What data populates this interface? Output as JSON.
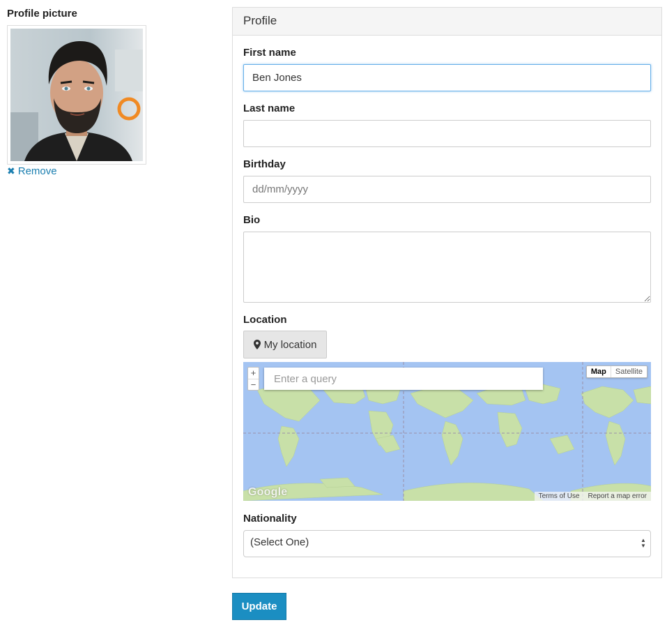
{
  "profile_picture": {
    "title": "Profile picture",
    "remove_label": "Remove"
  },
  "panel": {
    "heading": "Profile"
  },
  "fields": {
    "first_name": {
      "label": "First name",
      "value": "Ben Jones"
    },
    "last_name": {
      "label": "Last name",
      "value": ""
    },
    "birthday": {
      "label": "Birthday",
      "placeholder": "dd/mm/yyyy"
    },
    "bio": {
      "label": "Bio",
      "value": ""
    },
    "location": {
      "label": "Location",
      "button_label": "My location",
      "map": {
        "search_placeholder": "Enter a query",
        "zoom_in": "+",
        "zoom_out": "−",
        "type_map": "Map",
        "type_satellite": "Satellite",
        "logo": "Google",
        "terms": "Terms of Use",
        "report": "Report a map error"
      }
    },
    "nationality": {
      "label": "Nationality",
      "selected": "(Select One)"
    }
  },
  "actions": {
    "update_label": "Update"
  },
  "colors": {
    "primary": "#1b8ec2",
    "link": "#1b7fb0",
    "map_water": "#a4c4f2",
    "map_land": "#c8e0a8"
  },
  "icons": {
    "remove": "close-icon",
    "location": "map-marker-icon",
    "select": "select-arrows-icon"
  }
}
